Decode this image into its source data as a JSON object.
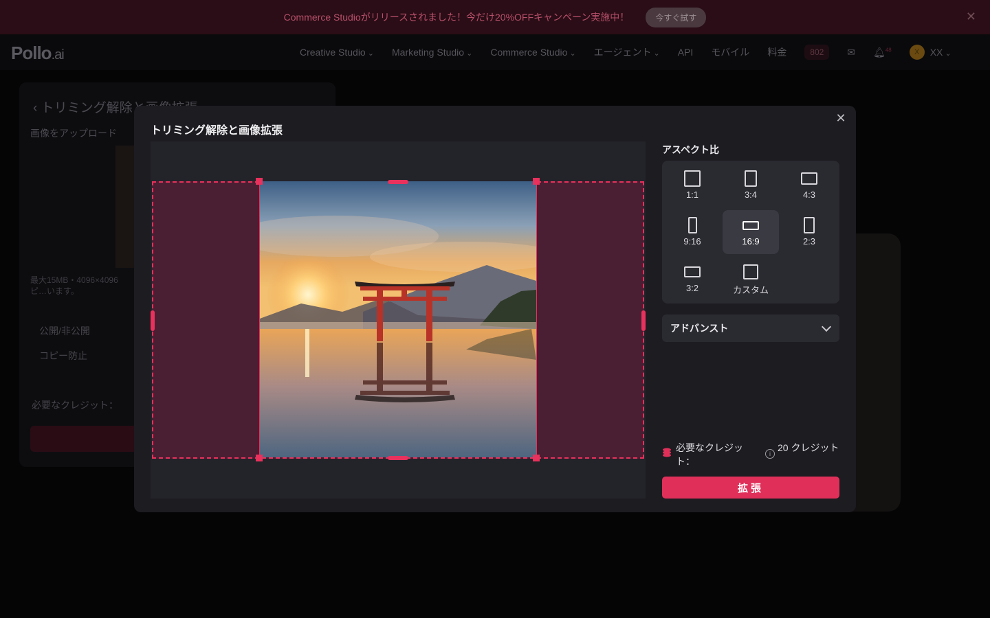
{
  "banner": {
    "text": "Commerce Studioがリリースされました！今だけ20%OFFキャンペーン実施中！",
    "button": "今すぐ試す"
  },
  "header": {
    "logo": "Pollo",
    "logo_suffix": ".ai",
    "nav": [
      "Creative Studio",
      "Marketing Studio",
      "Commerce Studio",
      "エージェント",
      "API",
      "モバイル",
      "料金"
    ],
    "credits": "802",
    "notifications": "48",
    "user_initial": "X",
    "user_name": "XX"
  },
  "background_page": {
    "title": "トリミング解除と画像拡張",
    "upload_label": "画像をアップロード",
    "note": "最大15MB・4096×4096ピ…います。",
    "public_toggle": "公開/非公開",
    "copy_protect": "コピー防止",
    "credits_label": "必要なクレジット："
  },
  "modal": {
    "title": "トリミング解除と画像拡張",
    "aspect_label": "アスペクト比",
    "ratios": [
      {
        "label": "1:1",
        "selected": false
      },
      {
        "label": "3:4",
        "selected": false
      },
      {
        "label": "4:3",
        "selected": false
      },
      {
        "label": "9:16",
        "selected": false
      },
      {
        "label": "16:9",
        "selected": true
      },
      {
        "label": "2:3",
        "selected": false
      },
      {
        "label": "3:2",
        "selected": false
      },
      {
        "label": "カスタム",
        "selected": false
      }
    ],
    "advanced_label": "アドバンスト",
    "credits_label": "必要なクレジット：",
    "credits_value": "20 クレジット",
    "extend_button": "拡張"
  },
  "colors": {
    "accent": "#e0305a",
    "extend_fill": "#4a1f33",
    "modal_bg": "#1c1c21"
  }
}
